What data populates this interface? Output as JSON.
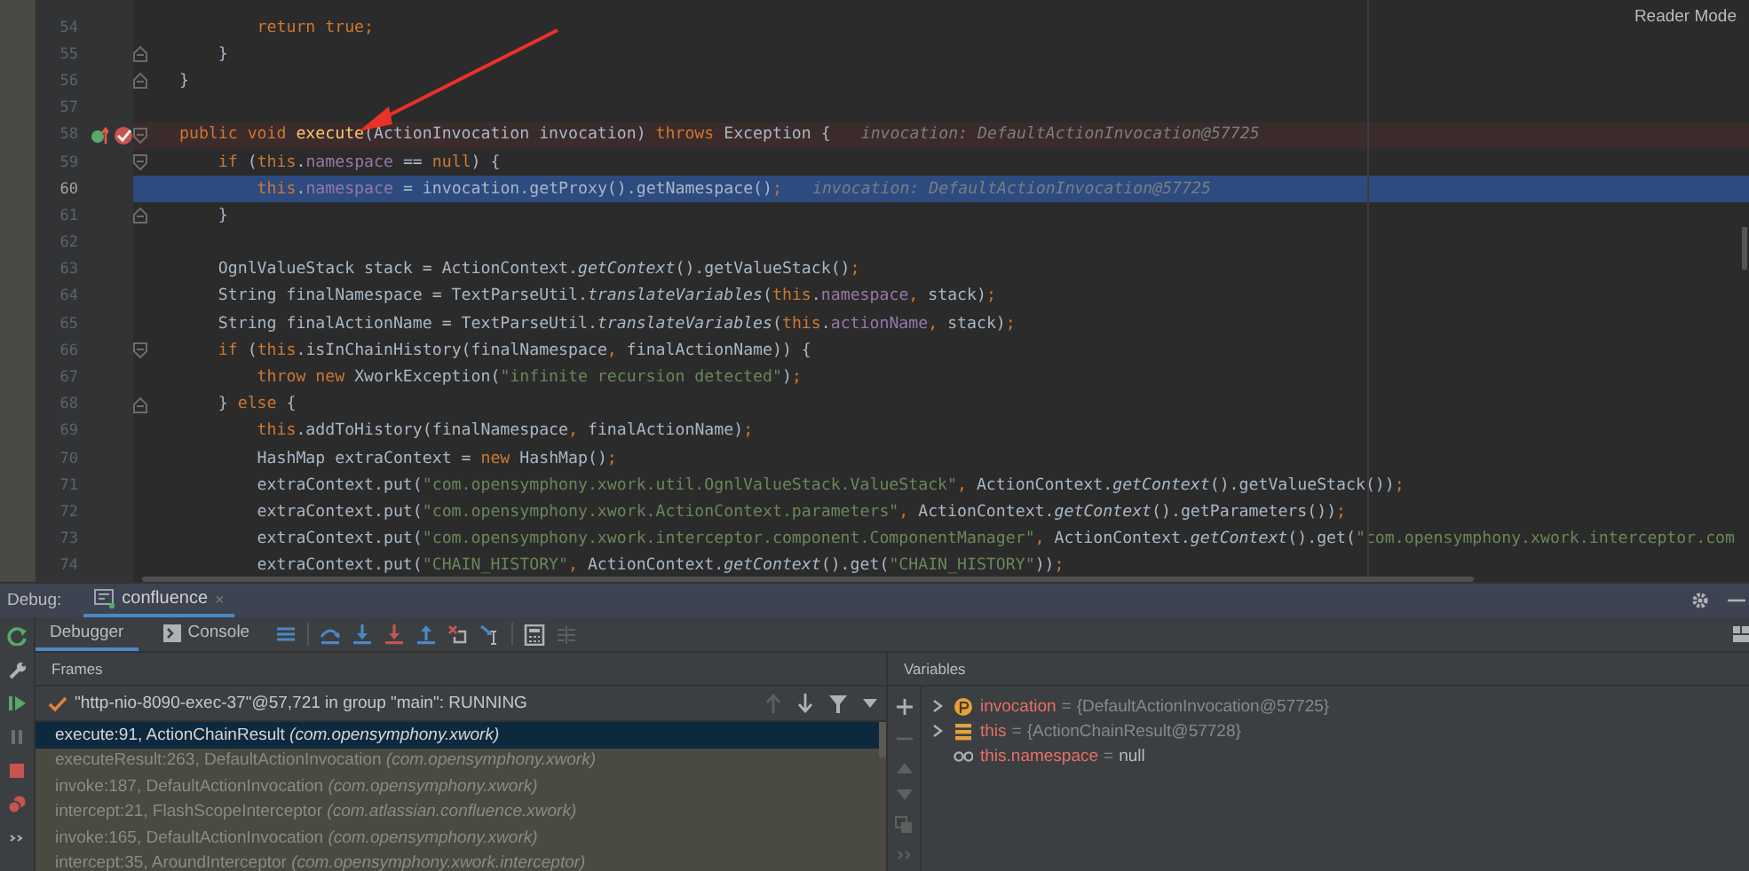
{
  "editor": {
    "reader_mode": "Reader Mode",
    "lines": [
      {
        "number": "54",
        "tokens": [
          {
            "kind": "kw",
            "text": "        return true;"
          }
        ]
      },
      {
        "number": "55",
        "fold_close": true,
        "tokens": [
          {
            "kind": "plain",
            "text": "    }"
          }
        ]
      },
      {
        "number": "56",
        "fold_close": true,
        "tokens": [
          {
            "kind": "plain",
            "text": "}"
          }
        ]
      },
      {
        "number": "57"
      },
      {
        "number": "58",
        "fold_open": true,
        "breakpoint": true,
        "override": true,
        "tokens": [
          {
            "kind": "kw",
            "text": "public void "
          },
          {
            "kind": "decl",
            "text": "execute"
          },
          {
            "kind": "plain",
            "text": "(ActionInvocation invocation) "
          },
          {
            "kind": "kw",
            "text": "throws "
          },
          {
            "kind": "plain",
            "text": "Exception {"
          }
        ],
        "hint": "invocation: DefaultActionInvocation@57725"
      },
      {
        "number": "59",
        "fold_open": true,
        "tokens": [
          {
            "kind": "kw",
            "text": "    if "
          },
          {
            "kind": "plain",
            "text": "("
          },
          {
            "kind": "kw",
            "text": "this"
          },
          {
            "kind": "plain",
            "text": "."
          },
          {
            "kind": "field",
            "text": "namespace"
          },
          {
            "kind": "plain",
            "text": " == "
          },
          {
            "kind": "kw",
            "text": "null"
          },
          {
            "kind": "plain",
            "text": ") {"
          }
        ]
      },
      {
        "number": "60",
        "current": true,
        "tokens": [
          {
            "kind": "kw",
            "text": "        this"
          },
          {
            "kind": "plain",
            "text": "."
          },
          {
            "kind": "field",
            "text": "namespace"
          },
          {
            "kind": "plain",
            "text": " = invocation.getProxy().getNamespace()"
          },
          {
            "kind": "kw",
            "text": ";"
          }
        ],
        "hint": "invocation: DefaultActionInvocation@57725"
      },
      {
        "number": "61",
        "fold_close": true,
        "tokens": [
          {
            "kind": "plain",
            "text": "    }"
          }
        ]
      },
      {
        "number": "62"
      },
      {
        "number": "63",
        "tokens": [
          {
            "kind": "plain",
            "text": "    OgnlValueStack stack = ActionContext."
          },
          {
            "kind": "static",
            "text": "getContext"
          },
          {
            "kind": "plain",
            "text": "().getValueStack()"
          },
          {
            "kind": "kw",
            "text": ";"
          }
        ]
      },
      {
        "number": "64",
        "tokens": [
          {
            "kind": "plain",
            "text": "    String finalNamespace = TextParseUtil."
          },
          {
            "kind": "static",
            "text": "translateVariables"
          },
          {
            "kind": "plain",
            "text": "("
          },
          {
            "kind": "kw",
            "text": "this"
          },
          {
            "kind": "plain",
            "text": "."
          },
          {
            "kind": "field",
            "text": "namespace"
          },
          {
            "kind": "kw",
            "text": ", "
          },
          {
            "kind": "plain",
            "text": "stack)"
          },
          {
            "kind": "kw",
            "text": ";"
          }
        ]
      },
      {
        "number": "65",
        "tokens": [
          {
            "kind": "plain",
            "text": "    String finalActionName = TextParseUtil."
          },
          {
            "kind": "static",
            "text": "translateVariables"
          },
          {
            "kind": "plain",
            "text": "("
          },
          {
            "kind": "kw",
            "text": "this"
          },
          {
            "kind": "plain",
            "text": "."
          },
          {
            "kind": "field",
            "text": "actionName"
          },
          {
            "kind": "kw",
            "text": ", "
          },
          {
            "kind": "plain",
            "text": "stack)"
          },
          {
            "kind": "kw",
            "text": ";"
          }
        ]
      },
      {
        "number": "66",
        "fold_open": true,
        "tokens": [
          {
            "kind": "kw",
            "text": "    if "
          },
          {
            "kind": "plain",
            "text": "("
          },
          {
            "kind": "kw",
            "text": "this"
          },
          {
            "kind": "plain",
            "text": ".isInChainHistory(finalNamespace"
          },
          {
            "kind": "kw",
            "text": ", "
          },
          {
            "kind": "plain",
            "text": "finalActionName)) {"
          }
        ]
      },
      {
        "number": "67",
        "tokens": [
          {
            "kind": "kw",
            "text": "        throw new "
          },
          {
            "kind": "plain",
            "text": "XworkException("
          },
          {
            "kind": "str",
            "text": "\"infinite recursion detected\""
          },
          {
            "kind": "plain",
            "text": ")"
          },
          {
            "kind": "kw",
            "text": ";"
          }
        ]
      },
      {
        "number": "68",
        "fold_close": true,
        "tokens": [
          {
            "kind": "plain",
            "text": "    } "
          },
          {
            "kind": "kw",
            "text": "else "
          },
          {
            "kind": "plain",
            "text": "{"
          }
        ]
      },
      {
        "number": "69",
        "tokens": [
          {
            "kind": "kw",
            "text": "        this"
          },
          {
            "kind": "plain",
            "text": ".addToHistory(finalNamespace"
          },
          {
            "kind": "kw",
            "text": ", "
          },
          {
            "kind": "plain",
            "text": "finalActionName)"
          },
          {
            "kind": "kw",
            "text": ";"
          }
        ]
      },
      {
        "number": "70",
        "tokens": [
          {
            "kind": "plain",
            "text": "        HashMap extraContext = "
          },
          {
            "kind": "kw",
            "text": "new "
          },
          {
            "kind": "plain",
            "text": "HashMap()"
          },
          {
            "kind": "kw",
            "text": ";"
          }
        ]
      },
      {
        "number": "71",
        "tokens": [
          {
            "kind": "plain",
            "text": "        extraContext.put("
          },
          {
            "kind": "str",
            "text": "\"com.opensymphony.xwork.util.OgnlValueStack.ValueStack\""
          },
          {
            "kind": "kw",
            "text": ", "
          },
          {
            "kind": "plain",
            "text": "ActionContext."
          },
          {
            "kind": "static",
            "text": "getContext"
          },
          {
            "kind": "plain",
            "text": "().getValueStack())"
          },
          {
            "kind": "kw",
            "text": ";"
          }
        ]
      },
      {
        "number": "72",
        "tokens": [
          {
            "kind": "plain",
            "text": "        extraContext.put("
          },
          {
            "kind": "str",
            "text": "\"com.opensymphony.xwork.ActionContext.parameters\""
          },
          {
            "kind": "kw",
            "text": ", "
          },
          {
            "kind": "plain",
            "text": "ActionContext."
          },
          {
            "kind": "static",
            "text": "getContext"
          },
          {
            "kind": "plain",
            "text": "().getParameters())"
          },
          {
            "kind": "kw",
            "text": ";"
          }
        ]
      },
      {
        "number": "73",
        "tokens": [
          {
            "kind": "plain",
            "text": "        extraContext.put("
          },
          {
            "kind": "str",
            "text": "\"com.opensymphony.xwork.interceptor.component.ComponentManager\""
          },
          {
            "kind": "kw",
            "text": ", "
          },
          {
            "kind": "plain",
            "text": "ActionContext."
          },
          {
            "kind": "static",
            "text": "getContext"
          },
          {
            "kind": "plain",
            "text": "().get("
          },
          {
            "kind": "str",
            "text": "\"com.opensymphony.xwork.interceptor.com"
          }
        ]
      },
      {
        "number": "74",
        "tokens": [
          {
            "kind": "plain",
            "text": "        extraContext.put("
          },
          {
            "kind": "str",
            "text": "\"CHAIN_HISTORY\""
          },
          {
            "kind": "kw",
            "text": ", "
          },
          {
            "kind": "plain",
            "text": "ActionContext."
          },
          {
            "kind": "static",
            "text": "getContext"
          },
          {
            "kind": "plain",
            "text": "().get("
          },
          {
            "kind": "str",
            "text": "\"CHAIN_HISTORY\""
          },
          {
            "kind": "plain",
            "text": "))"
          },
          {
            "kind": "kw",
            "text": ";"
          }
        ]
      }
    ]
  },
  "debug": {
    "label": "Debug:",
    "session_tab": {
      "label": "confluence",
      "close": "×",
      "selected": true
    },
    "tabs": [
      {
        "label": "Debugger",
        "selected": true
      },
      {
        "label": "Console",
        "selected": false
      }
    ],
    "frames_title": "Frames",
    "variables_title": "Variables",
    "thread": "\"http-nio-8090-exec-37\"@57,721 in group \"main\": RUNNING",
    "frames": [
      {
        "method": "execute:91, ActionChainResult",
        "package": "(com.opensymphony.xwork)",
        "selected": true,
        "library": false
      },
      {
        "method": "executeResult:263, DefaultActionInvocation",
        "package": "(com.opensymphony.xwork)",
        "selected": false,
        "library": true
      },
      {
        "method": "invoke:187, DefaultActionInvocation",
        "package": "(com.opensymphony.xwork)",
        "selected": false,
        "library": true
      },
      {
        "method": "intercept:21, FlashScopeInterceptor",
        "package": "(com.atlassian.confluence.xwork)",
        "selected": false,
        "library": true
      },
      {
        "method": "invoke:165, DefaultActionInvocation",
        "package": "(com.opensymphony.xwork)",
        "selected": false,
        "library": true
      },
      {
        "method": "intercept:35, AroundInterceptor",
        "package": "(com.opensymphony.xwork.interceptor)",
        "selected": false,
        "library": true
      }
    ],
    "variables": [
      {
        "kind": "parameter",
        "name": "invocation",
        "operator": "=",
        "value": "{DefaultActionInvocation@57725}",
        "expandable": true
      },
      {
        "kind": "field",
        "name": "this",
        "operator": "=",
        "value": "{ActionChainResult@57728}",
        "expandable": true
      },
      {
        "kind": "watch",
        "name": "this.namespace",
        "operator": "=",
        "value": "null",
        "expandable": false
      }
    ]
  }
}
